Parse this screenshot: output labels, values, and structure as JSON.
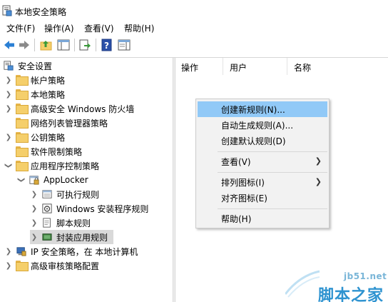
{
  "window": {
    "title": "本地安全策略"
  },
  "menubar": {
    "items": [
      "文件(F)",
      "操作(A)",
      "查看(V)",
      "帮助(H)"
    ]
  },
  "tree": {
    "root": "安全设置",
    "items": [
      {
        "label": "帐户策略",
        "expanded": false,
        "icon": "folder-lock-icon"
      },
      {
        "label": "本地策略",
        "expanded": false,
        "icon": "folder-lock-icon"
      },
      {
        "label": "高级安全 Windows 防火墙",
        "expanded": false,
        "icon": "folder-icon"
      },
      {
        "label": "网络列表管理器策略",
        "expanded": null,
        "icon": "folder-icon"
      },
      {
        "label": "公钥策略",
        "expanded": false,
        "icon": "folder-icon"
      },
      {
        "label": "软件限制策略",
        "expanded": null,
        "icon": "folder-icon"
      },
      {
        "label": "应用程序控制策略",
        "expanded": true,
        "icon": "folder-icon"
      },
      {
        "label": "AppLocker",
        "expanded": true,
        "icon": "applocker-icon"
      },
      {
        "label": "可执行规则",
        "expanded": false,
        "icon": "executable-rules-icon"
      },
      {
        "label": "Windows 安装程序规则",
        "expanded": false,
        "icon": "installer-rules-icon"
      },
      {
        "label": "脚本规则",
        "expanded": false,
        "icon": "script-rules-icon"
      },
      {
        "label": "封装应用规则",
        "expanded": false,
        "icon": "packaged-app-rules-icon",
        "selected": true
      },
      {
        "label": "IP 安全策略，在 本地计算机",
        "expanded": false,
        "icon": "ip-security-icon"
      },
      {
        "label": "高级审核策略配置",
        "expanded": false,
        "icon": "folder-icon"
      }
    ]
  },
  "list": {
    "columns": [
      "操作",
      "用户",
      "名称"
    ]
  },
  "context_menu": {
    "items": [
      {
        "label": "创建新规则(N)...",
        "highlighted": true
      },
      {
        "label": "自动生成规则(A)..."
      },
      {
        "label": "创建默认规则(D)"
      },
      {
        "separator": true
      },
      {
        "label": "查看(V)",
        "submenu": true
      },
      {
        "separator": true
      },
      {
        "label": "排列图标(I)",
        "submenu": true
      },
      {
        "label": "对齐图标(E)"
      },
      {
        "separator": true
      },
      {
        "label": "帮助(H)"
      }
    ]
  },
  "watermark": {
    "url": "jb51.net",
    "brand": "脚本之家"
  },
  "colors": {
    "highlight": "#91c9f7",
    "selected_row": "#d9d9d9",
    "folder": "#f5cf6b"
  }
}
